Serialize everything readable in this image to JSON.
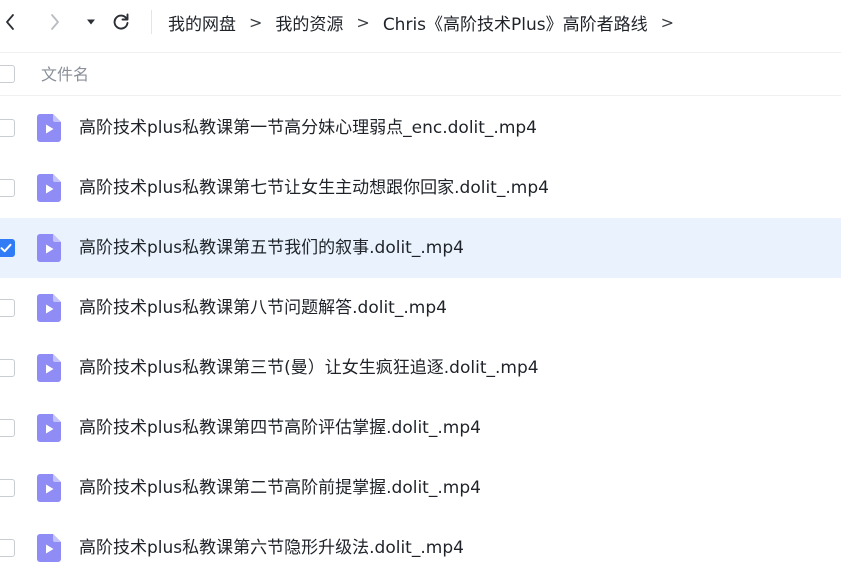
{
  "nav": {
    "back_icon": "chevron-left-icon",
    "forward_icon": "chevron-right-icon",
    "dropdown_icon": "caret-down-icon",
    "refresh_icon": "refresh-icon"
  },
  "breadcrumb": {
    "items": [
      "我的网盘",
      "我的资源",
      "Chris《高阶技术Plus》高阶者路线"
    ],
    "separator": ">"
  },
  "list_header": {
    "name_column": "文件名"
  },
  "files": [
    {
      "name": "高阶技术plus私教课第一节高分妹心理弱点_enc.dolit_.mp4",
      "checked": false,
      "icon": "video-file-icon"
    },
    {
      "name": "高阶技术plus私教课第七节让女生主动想跟你回家.dolit_.mp4",
      "checked": false,
      "icon": "video-file-icon"
    },
    {
      "name": "高阶技术plus私教课第五节我们的叙事.dolit_.mp4",
      "checked": true,
      "icon": "video-file-icon"
    },
    {
      "name": "高阶技术plus私教课第八节问题解答.dolit_.mp4",
      "checked": false,
      "icon": "video-file-icon"
    },
    {
      "name": "高阶技术plus私教课第三节(曼）让女生疯狂追逐.dolit_.mp4",
      "checked": false,
      "icon": "video-file-icon"
    },
    {
      "name": "高阶技术plus私教课第四节高阶评估掌握.dolit_.mp4",
      "checked": false,
      "icon": "video-file-icon"
    },
    {
      "name": "高阶技术plus私教课第二节高阶前提掌握.dolit_.mp4",
      "checked": false,
      "icon": "video-file-icon"
    },
    {
      "name": "高阶技术plus私教课第六节隐形升级法.dolit_.mp4",
      "checked": false,
      "icon": "video-file-icon"
    }
  ],
  "colors": {
    "accent": "#2f7cf6",
    "selected_row": "#eaf3fd",
    "file_icon": "#8f8cf5"
  }
}
